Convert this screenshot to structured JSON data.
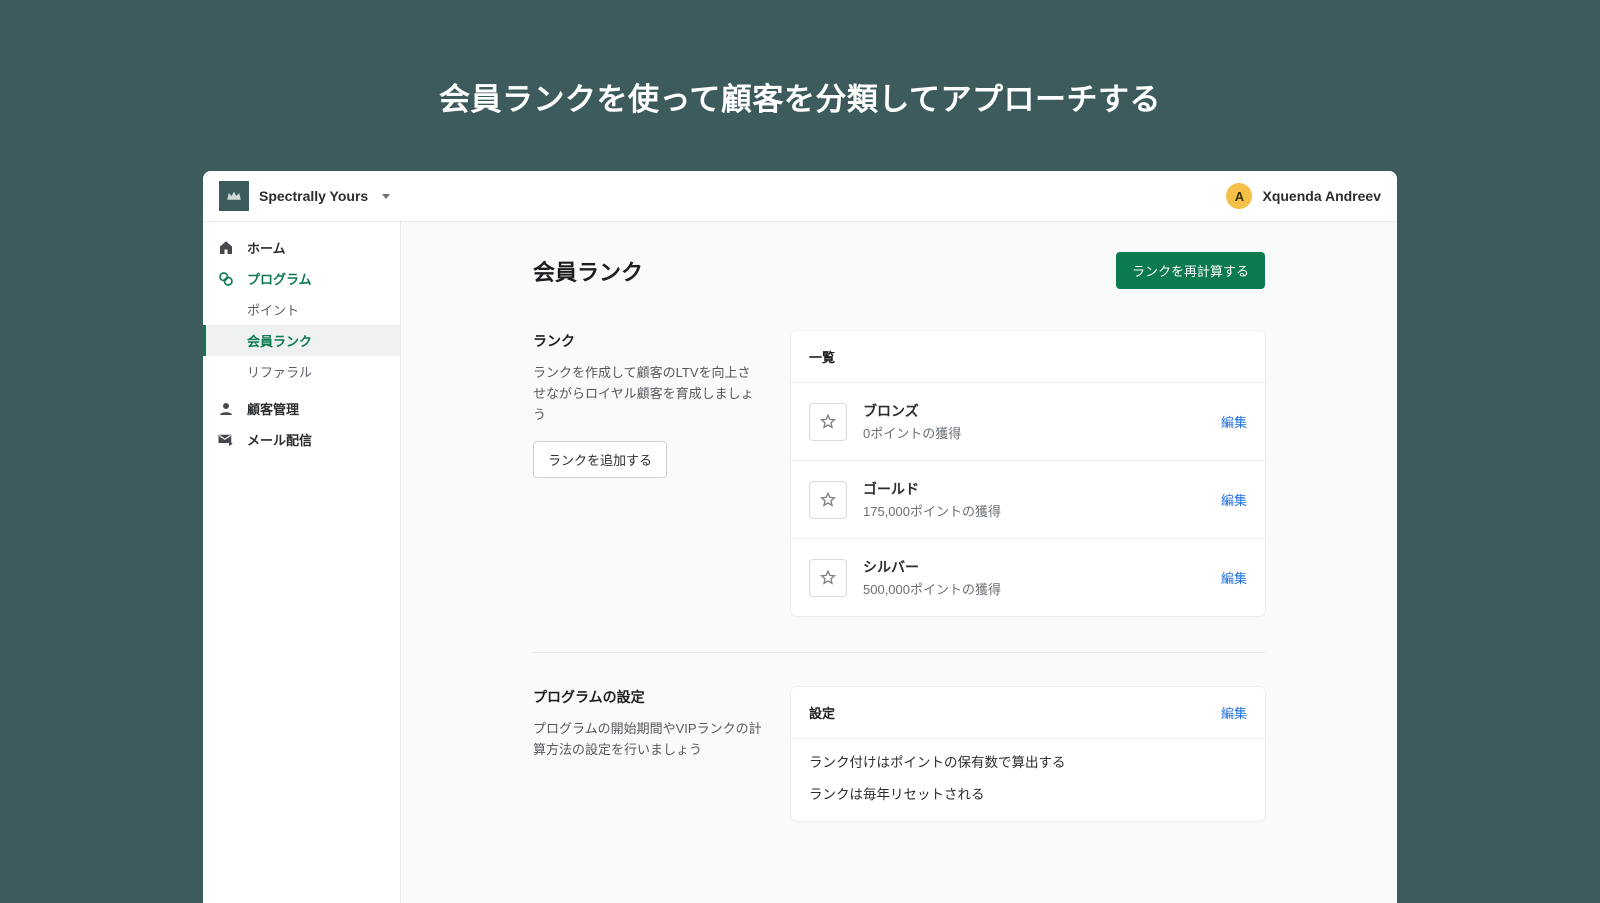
{
  "hero": {
    "title": "会員ランクを使って顧客を分類してアプローチする"
  },
  "topbar": {
    "brand_name": "Spectrally Yours",
    "user_initial": "A",
    "user_name": "Xquenda Andreev"
  },
  "sidebar": {
    "home": "ホーム",
    "program": "プログラム",
    "points": "ポイント",
    "member_rank": "会員ランク",
    "referral": "リファラル",
    "customers": "顧客管理",
    "mail": "メール配信"
  },
  "page": {
    "title": "会員ランク",
    "recalc_button": "ランクを再計算する"
  },
  "rank_section": {
    "title": "ランク",
    "description": "ランクを作成して顧客のLTVを向上させながらロイヤル顧客を育成しましょう",
    "add_button": "ランクを追加する"
  },
  "rank_list": {
    "header": "一覧",
    "edit_label": "編集",
    "items": [
      {
        "name": "ブロンズ",
        "sub": "0ポイントの獲得"
      },
      {
        "name": "ゴールド",
        "sub": "175,000ポイントの獲得"
      },
      {
        "name": "シルバー",
        "sub": "500,000ポイントの獲得"
      }
    ]
  },
  "program_settings": {
    "title": "プログラムの設定",
    "description": "プログラムの開始期間やVIPランクの計算方法の設定を行いましょう",
    "card_header": "設定",
    "edit_label": "編集",
    "line1": "ランク付けはポイントの保有数で算出する",
    "line2": "ランクは毎年リセットされる"
  }
}
